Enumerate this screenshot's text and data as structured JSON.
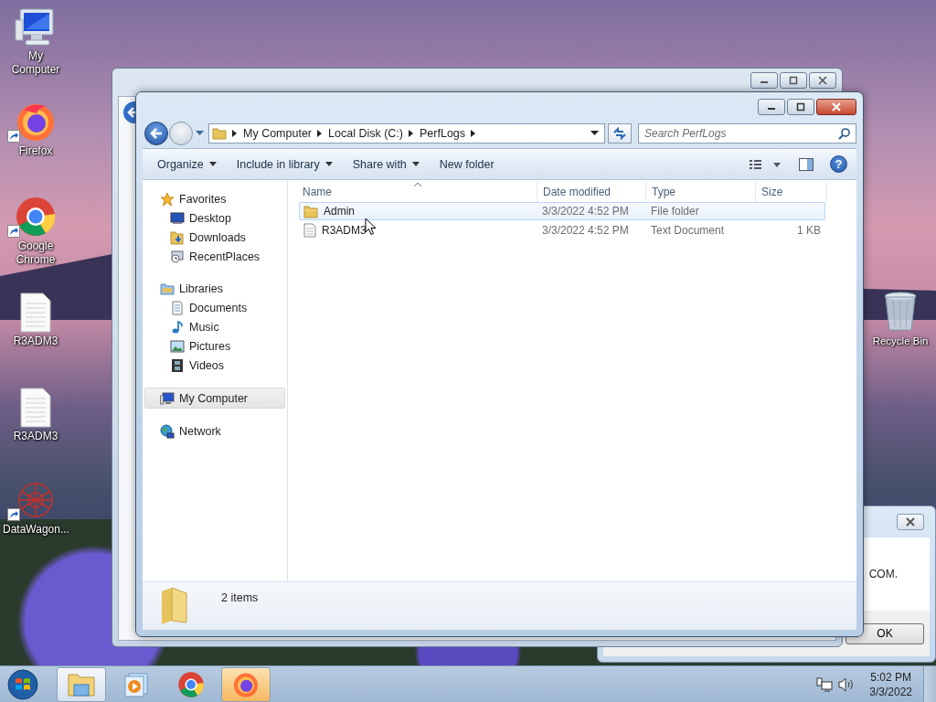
{
  "desktop_icons": [
    {
      "label": "My Computer",
      "kind": "computer",
      "shortcut": false
    },
    {
      "label": "Firefox",
      "kind": "firefox",
      "shortcut": true
    },
    {
      "label": "Google Chrome",
      "kind": "chrome",
      "shortcut": true
    },
    {
      "label": "R3ADM3",
      "kind": "textfile",
      "shortcut": false
    },
    {
      "label": "R3ADM3",
      "kind": "textfile",
      "shortcut": false
    },
    {
      "label": "DataWagon...",
      "kind": "web",
      "shortcut": true
    }
  ],
  "recycle_bin": {
    "label": "Recycle Bin"
  },
  "explorer": {
    "breadcrumb": [
      "My Computer",
      "Local Disk (C:)",
      "PerfLogs"
    ],
    "search": {
      "placeholder": "Search PerfLogs"
    },
    "toolbar": [
      {
        "label": "Organize",
        "dropdown": true
      },
      {
        "label": "Include in library",
        "dropdown": true
      },
      {
        "label": "Share with",
        "dropdown": true
      },
      {
        "label": "New folder",
        "dropdown": false
      }
    ],
    "sidebar": [
      {
        "label": "Favorites",
        "kind": "star",
        "selected": false,
        "children": [
          {
            "label": "Desktop",
            "kind": "desktop"
          },
          {
            "label": "Downloads",
            "kind": "downloads"
          },
          {
            "label": "RecentPlaces",
            "kind": "recent"
          }
        ]
      },
      {
        "label": "Libraries",
        "kind": "library",
        "selected": false,
        "children": [
          {
            "label": "Documents",
            "kind": "documents"
          },
          {
            "label": "Music",
            "kind": "music"
          },
          {
            "label": "Pictures",
            "kind": "pictures"
          },
          {
            "label": "Videos",
            "kind": "videos"
          }
        ]
      },
      {
        "label": "My Computer",
        "kind": "computer",
        "selected": true
      },
      {
        "label": "Network",
        "kind": "network",
        "selected": false
      }
    ],
    "columns": [
      "Name",
      "Date modified",
      "Type",
      "Size"
    ],
    "rows": [
      {
        "name": "Admin",
        "date": "3/3/2022 4:52 PM",
        "type": "File folder",
        "kind": "folder",
        "highlighted": true
      },
      {
        "name": "R3ADM3",
        "date": "3/3/2022 4:52 PM",
        "type": "Text Document",
        "size": "1 KB",
        "kind": "textfile",
        "highlighted": false
      }
    ],
    "help": "?",
    "status": "2 items"
  },
  "dialog": {
    "text": "COM.",
    "button": "OK"
  },
  "taskbar": {
    "buttons": [
      {
        "kind": "explorer",
        "active": true
      },
      {
        "kind": "media",
        "active": false
      },
      {
        "kind": "chrome",
        "active": false
      },
      {
        "kind": "firefox",
        "active": true
      }
    ],
    "time": "5:02 PM",
    "date": "3/3/2022"
  }
}
